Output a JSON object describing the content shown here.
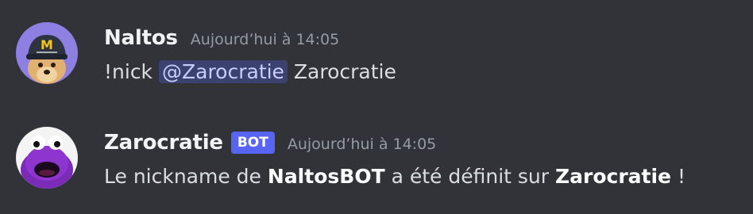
{
  "messages": [
    {
      "avatar_icon": "dog-mcdonalds-cap-avatar",
      "username": "Naltos",
      "timestamp": "Aujourd’hui à 14:05",
      "command": "!nick",
      "mention": "@Zarocratie",
      "argument": "Zarocratie"
    },
    {
      "avatar_icon": "purple-cookie-monster-avatar",
      "username": "Zarocratie",
      "bot_tag": "BOT",
      "timestamp": "Aujourd’hui à 14:05",
      "text_before": "Le nickname de",
      "bold_name": "NaltosBOT",
      "text_middle": "a été définit sur",
      "bold_value": "Zarocratie",
      "text_end": "!"
    }
  ],
  "colors": {
    "background": "#313338",
    "bot_tag": "#5865f2",
    "mention_bg": "#3c4270",
    "mention_text": "#c9cdfb",
    "timestamp": "#949ba4"
  }
}
